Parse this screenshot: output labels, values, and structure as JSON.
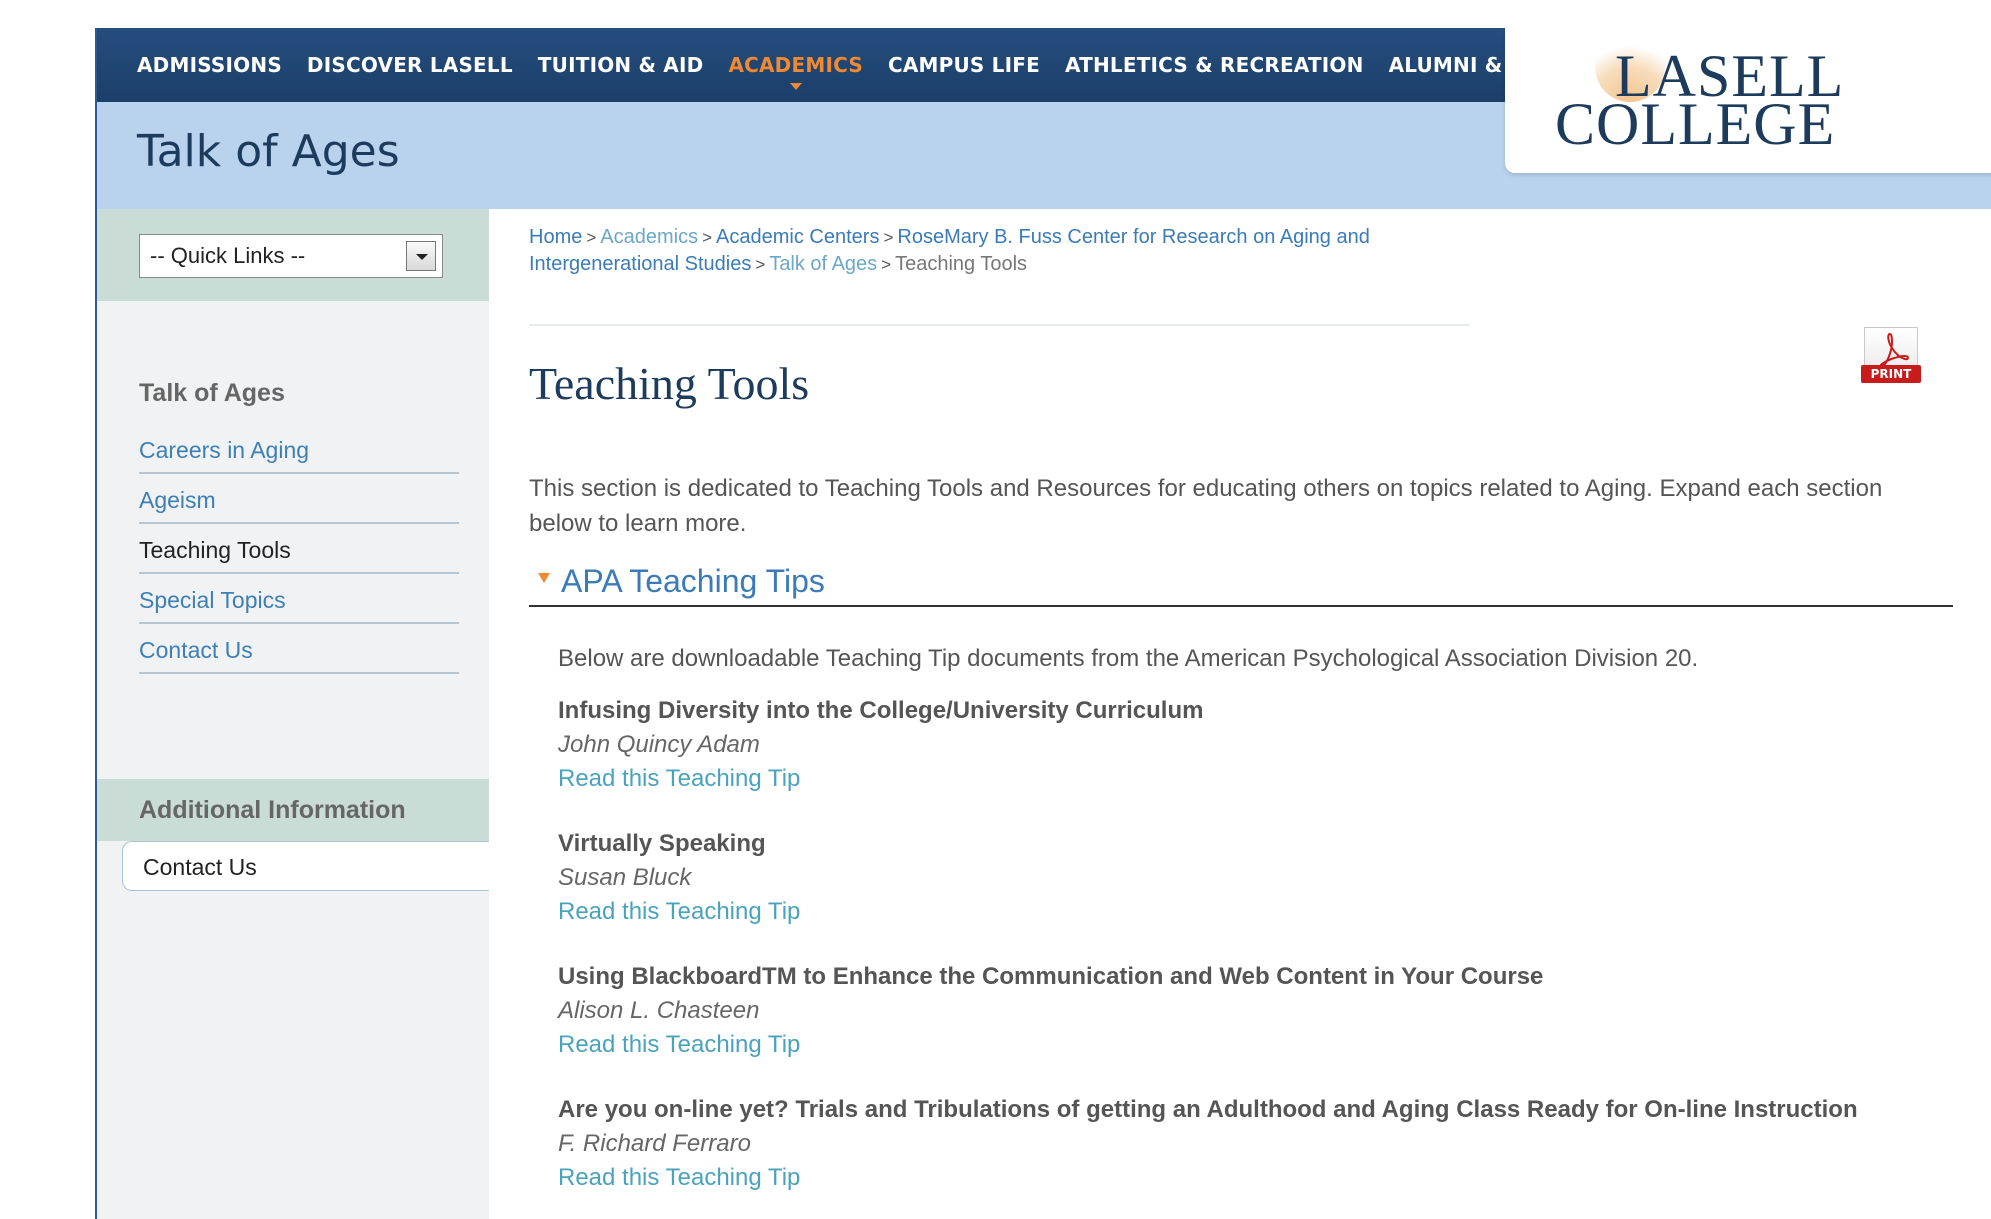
{
  "nav": {
    "items": [
      {
        "label": "ADMISSIONS"
      },
      {
        "label": "DISCOVER LASELL"
      },
      {
        "label": "TUITION & AID"
      },
      {
        "label": "ACADEMICS"
      },
      {
        "label": "CAMPUS LIFE"
      },
      {
        "label": "ATHLETICS & RECREATION"
      },
      {
        "label": "ALUMNI & FRIENDS"
      }
    ],
    "active": "ACADEMICS"
  },
  "logo": {
    "line1": "LASELL",
    "line2": "COLLEGE"
  },
  "section_title": "Talk of Ages",
  "sidebar": {
    "quick_links": "-- Quick Links --",
    "heading": "Talk of Ages",
    "items": [
      {
        "label": "Careers in Aging"
      },
      {
        "label": "Ageism"
      },
      {
        "label": "Teaching Tools"
      },
      {
        "label": "Special Topics"
      },
      {
        "label": "Contact Us"
      }
    ],
    "current": "Teaching Tools",
    "additional_heading": "Additional Information",
    "additional_link": "Contact Us"
  },
  "breadcrumb": {
    "home": "Home",
    "academics": "Academics",
    "centers": "Academic Centers",
    "center": "RoseMary B. Fuss Center for Research on Aging and Intergenerational Studies",
    "talk": "Talk of Ages",
    "current": "Teaching Tools",
    "sep": ">"
  },
  "print_label": "PRINT",
  "page_title": "Teaching Tools",
  "intro": "This section is dedicated to Teaching Tools and Resources for educating others on topics related to Aging. Expand each section below to learn more.",
  "accordion": {
    "title": "APA Teaching Tips",
    "lead": "Below are downloadable Teaching Tip documents from the American Psychological Association Division 20.",
    "tips": [
      {
        "title": "Infusing Diversity into the College/University Curriculum",
        "author": "John Quincy Adam",
        "link": "Read this Teaching Tip"
      },
      {
        "title": "Virtually Speaking",
        "author": "Susan Bluck",
        "link": "Read this Teaching Tip"
      },
      {
        "title": "Using BlackboardTM to Enhance the Communication and Web Content in Your Course",
        "author": "Alison L. Chasteen",
        "link": "Read this Teaching Tip"
      },
      {
        "title": "Are you on-line yet? Trials and Tribulations of getting an Adulthood and Aging Class Ready for On-line Instruction",
        "author": "F. Richard Ferraro",
        "link": "Read this Teaching Tip"
      }
    ]
  },
  "colors": {
    "nav_bg": "#1c3f69",
    "active": "#f08a32",
    "link": "#3a7bb8",
    "title": "#1d3b5c"
  }
}
